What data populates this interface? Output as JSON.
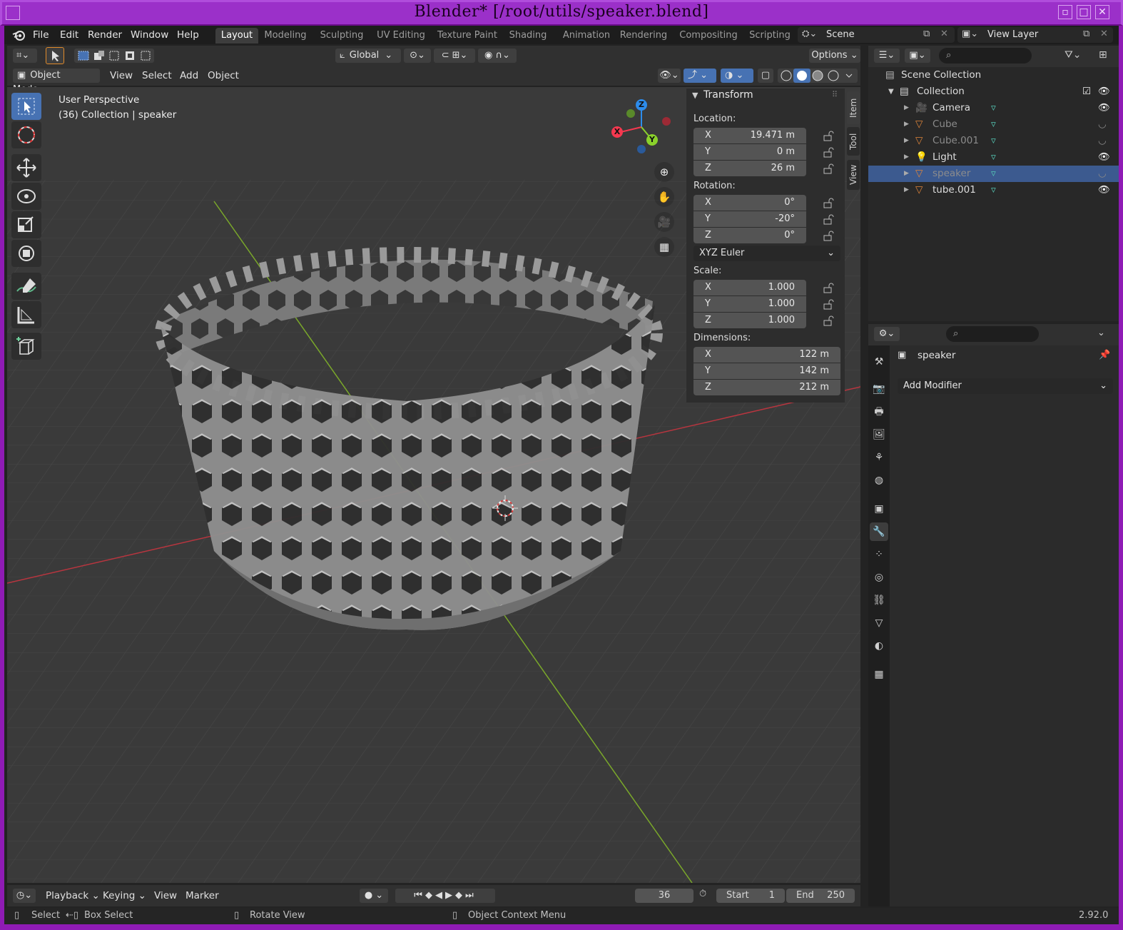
{
  "window": {
    "title": "Blender* [/root/utils/speaker.blend]",
    "buttons": [
      "▫",
      "□",
      "✕"
    ]
  },
  "menubar": {
    "items": [
      "File",
      "Edit",
      "Render",
      "Window",
      "Help"
    ]
  },
  "workspaces": {
    "tabs": [
      "Layout",
      "Modeling",
      "Sculpting",
      "UV Editing",
      "Texture Paint",
      "Shading",
      "Animation",
      "Rendering",
      "Compositing",
      "Scripting"
    ],
    "active": "Layout"
  },
  "scene": {
    "name": "Scene"
  },
  "view_layer": {
    "name": "View Layer"
  },
  "tool_header": {
    "orientation": "Global",
    "options_label": "Options"
  },
  "viewport_header": {
    "mode": "Object Mode",
    "menus": [
      "View",
      "Select",
      "Add",
      "Object"
    ]
  },
  "viewport": {
    "perspective": "User Perspective",
    "context": "(36) Collection | speaker",
    "gizmo_labels": {
      "x": "X",
      "y": "Y",
      "z": "Z"
    }
  },
  "side_tabs": [
    "Item",
    "Tool",
    "View"
  ],
  "transform": {
    "title": "Transform",
    "location_label": "Location:",
    "location": [
      {
        "axis": "X",
        "value": "19.471 m"
      },
      {
        "axis": "Y",
        "value": "0 m"
      },
      {
        "axis": "Z",
        "value": "26 m"
      }
    ],
    "rotation_label": "Rotation:",
    "rotation": [
      {
        "axis": "X",
        "value": "0°"
      },
      {
        "axis": "Y",
        "value": "-20°"
      },
      {
        "axis": "Z",
        "value": "0°"
      }
    ],
    "rotation_mode": "XYZ Euler",
    "scale_label": "Scale:",
    "scale": [
      {
        "axis": "X",
        "value": "1.000"
      },
      {
        "axis": "Y",
        "value": "1.000"
      },
      {
        "axis": "Z",
        "value": "1.000"
      }
    ],
    "dimensions_label": "Dimensions:",
    "dimensions": [
      {
        "axis": "X",
        "value": "122 m"
      },
      {
        "axis": "Y",
        "value": "142 m"
      },
      {
        "axis": "Z",
        "value": "212 m"
      }
    ]
  },
  "outliner": {
    "scene_collection": "Scene Collection",
    "collection": "Collection",
    "items": [
      {
        "name": "Camera",
        "icon": "camera-icon",
        "visible": true,
        "selected": false
      },
      {
        "name": "Cube",
        "icon": "mesh-icon",
        "visible": false,
        "selected": false
      },
      {
        "name": "Cube.001",
        "icon": "mesh-icon",
        "visible": false,
        "selected": false
      },
      {
        "name": "Light",
        "icon": "light-icon",
        "visible": true,
        "selected": false
      },
      {
        "name": "speaker",
        "icon": "mesh-icon",
        "visible": false,
        "selected": true
      },
      {
        "name": "tube.001",
        "icon": "mesh-icon",
        "visible": true,
        "selected": false
      }
    ]
  },
  "properties": {
    "object_name": "speaker",
    "add_modifier": "Add Modifier",
    "tabs": [
      "tool-icon",
      "render-icon",
      "output-icon",
      "view-layer-icon",
      "scene-icon",
      "world-icon",
      "object-icon",
      "modifier-icon",
      "particles-icon",
      "physics-icon",
      "constraints-icon",
      "data-icon",
      "material-icon",
      "texture-icon"
    ],
    "active_tab": "modifier-icon"
  },
  "timeline": {
    "menus": [
      "Playback",
      "Keying",
      "View",
      "Marker"
    ],
    "current_frame": "36",
    "start_label": "Start",
    "start": "1",
    "end_label": "End",
    "end": "250"
  },
  "statusbar": {
    "select": "Select",
    "box_select": "Box Select",
    "rotate_view": "Rotate View",
    "context_menu": "Object Context Menu",
    "version": "2.92.0"
  },
  "colors": {
    "accent": "#4772b3",
    "frame": "#9b30c9",
    "x_axis": "#f5384f",
    "y_axis": "#8ad12b",
    "z_axis": "#2d8ceb"
  }
}
